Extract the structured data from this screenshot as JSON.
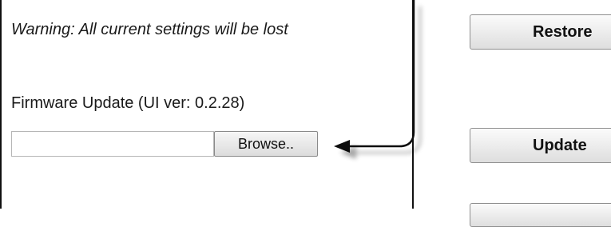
{
  "warning": {
    "text": "Warning: All current settings will be lost"
  },
  "firmware": {
    "label": "Firmware Update (UI ver: 0.2.28)",
    "file_value": "",
    "browse_label": "Browse.."
  },
  "buttons": {
    "restore_label": "Restore",
    "update_label": "Update"
  },
  "colors": {
    "frame": "#111111",
    "button_gradient_top": "#fbfbfb",
    "button_gradient_bottom": "#dedede"
  }
}
